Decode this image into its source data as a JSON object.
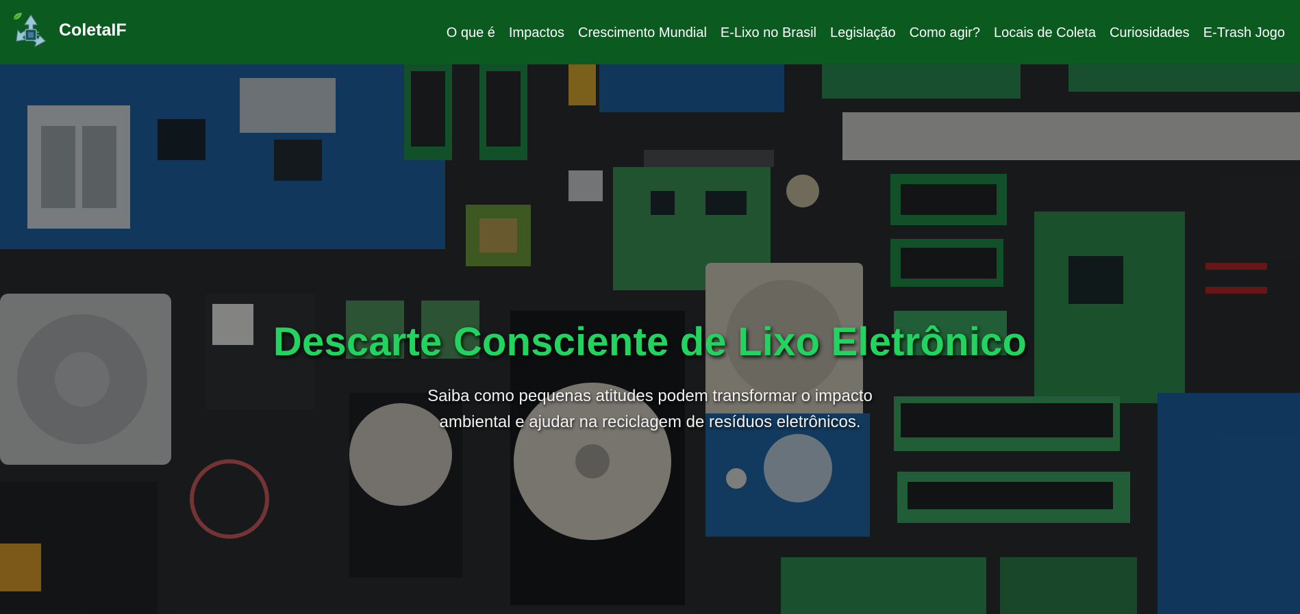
{
  "brand": {
    "name": "ColetaIF",
    "logo_icon": "recycle-chip-leaf-icon"
  },
  "nav": {
    "links": [
      "O que é",
      "Impactos",
      "Crescimento Mundial",
      "E-Lixo no Brasil",
      "Legislação",
      "Como agir?",
      "Locais de Coleta",
      "Curiosidades",
      "E-Trash Jogo"
    ]
  },
  "hero": {
    "title": "Descarte Consciente de Lixo Eletrônico",
    "subtitle": "Saiba como pequenas atitudes podem transformar o impacto ambiental e ajudar na reciclagem de resíduos eletrônicos.",
    "background": "electronic-components-photo"
  },
  "colors": {
    "navbar": "#0b5a1f",
    "title": "#22d35f",
    "text": "#ffffff"
  }
}
